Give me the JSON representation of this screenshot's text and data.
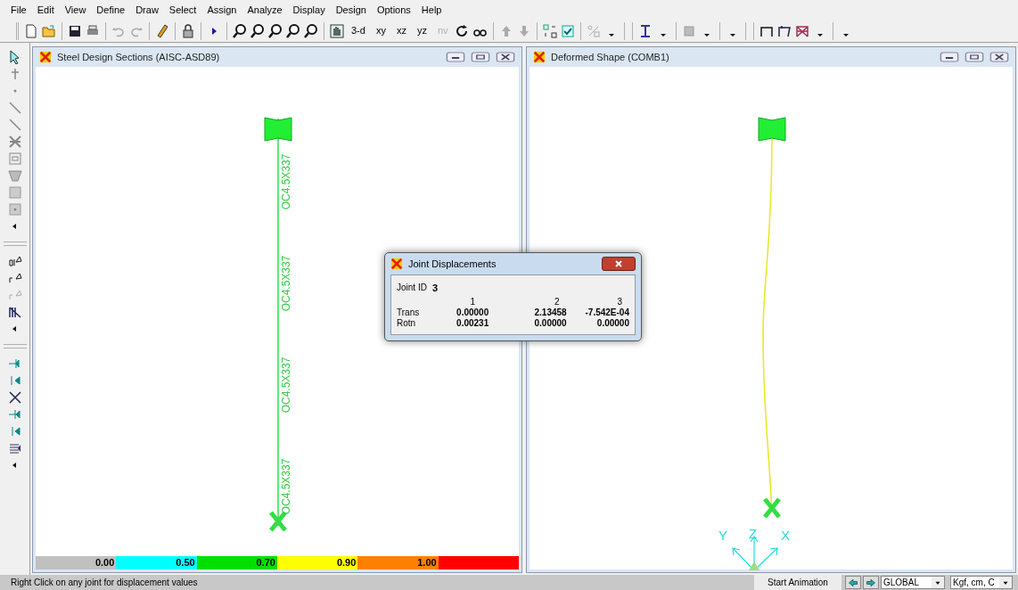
{
  "menu": [
    "File",
    "Edit",
    "View",
    "Define",
    "Draw",
    "Select",
    "Assign",
    "Analyze",
    "Display",
    "Design",
    "Options",
    "Help"
  ],
  "view_buttons": [
    {
      "label": "3-d",
      "disabled": false
    },
    {
      "label": "xy",
      "disabled": false
    },
    {
      "label": "xz",
      "disabled": false
    },
    {
      "label": "yz",
      "disabled": false
    },
    {
      "label": "nv",
      "disabled": true
    }
  ],
  "windows": [
    {
      "kind": "sections",
      "title": "Steel Design Sections (AISC-ASD89)",
      "frame_labels": [
        "OC4.5X337",
        "OC4.5X337",
        "OC4.5X337",
        "OC4.5X337"
      ],
      "legend": [
        {
          "label": "0.00",
          "color": "#c0c0c0"
        },
        {
          "label": "0.50",
          "color": "#00ffff"
        },
        {
          "label": "0.70",
          "color": "#00e000"
        },
        {
          "label": "0.90",
          "color": "#ffff00"
        },
        {
          "label": "1.00",
          "color": "#ff8000"
        },
        {
          "color": "#ff0000"
        }
      ]
    },
    {
      "kind": "deformed",
      "title": "Deformed Shape (COMB1)",
      "axes": [
        "Y",
        "Z",
        "X"
      ]
    }
  ],
  "dialog": {
    "title": "Joint Displacements",
    "joint_label": "Joint ID",
    "joint_id": "3",
    "columns": [
      "1",
      "2",
      "3"
    ],
    "rows": [
      {
        "label": "Trans",
        "values": [
          "0.00000",
          "2.13458",
          "-7.542E-04"
        ]
      },
      {
        "label": "Rotn",
        "values": [
          "0.00231",
          "0.00000",
          "0.00000"
        ]
      }
    ]
  },
  "status_bar": {
    "message": "Right Click on any joint for displacement values",
    "animation_button": "Start Animation",
    "coord_system": "GLOBAL",
    "units": "Kgf, cm, C"
  }
}
